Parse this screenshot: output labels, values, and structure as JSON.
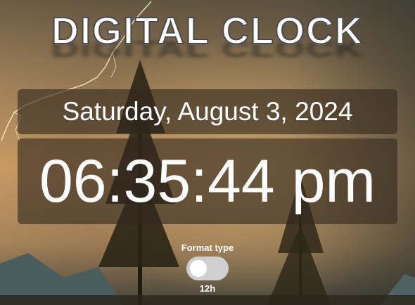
{
  "header": {
    "title": "DIGITAL CLOCK"
  },
  "clock": {
    "date": "Saturday, August 3, 2024",
    "time": "06:35:44 pm"
  },
  "format": {
    "label": "Format type",
    "value": "12h",
    "toggle_on": false
  },
  "colors": {
    "panel": "#32281e",
    "text": "#ffffff",
    "toggle_track": "#cfcfcf"
  }
}
